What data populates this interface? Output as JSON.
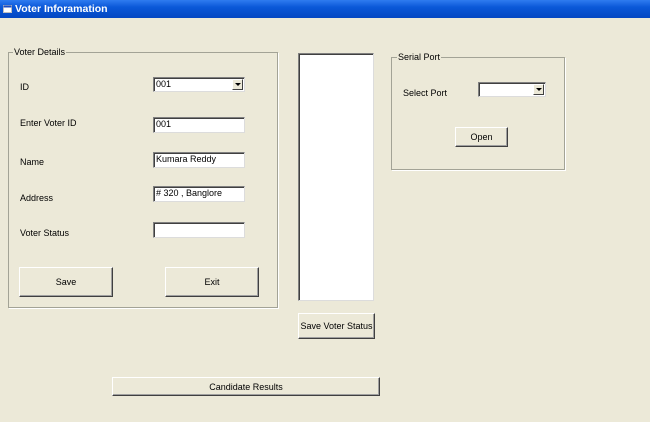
{
  "window": {
    "title": "Voter Inforamation"
  },
  "voter_details": {
    "legend": "Voter Details",
    "id_label": "ID",
    "id_value": "001",
    "voter_id_label": "Enter Voter ID",
    "voter_id_value": "001",
    "name_label": "Name",
    "name_value": "Kumara Reddy",
    "address_label": "Address",
    "address_value": "# 320 , Banglore",
    "status_label": "Voter Status",
    "status_value": "",
    "save_label": "Save",
    "exit_label": "Exit"
  },
  "status_list": {
    "items": []
  },
  "save_status_label": "Save Voter Status",
  "serial_port": {
    "legend": "Serial Port",
    "select_label": "Select Port",
    "selected_port": "",
    "open_label": "Open"
  },
  "candidate_results_label": "Candidate Results",
  "icons": {
    "app": "window-app-icon",
    "dropdown": "chevron-down-icon"
  }
}
